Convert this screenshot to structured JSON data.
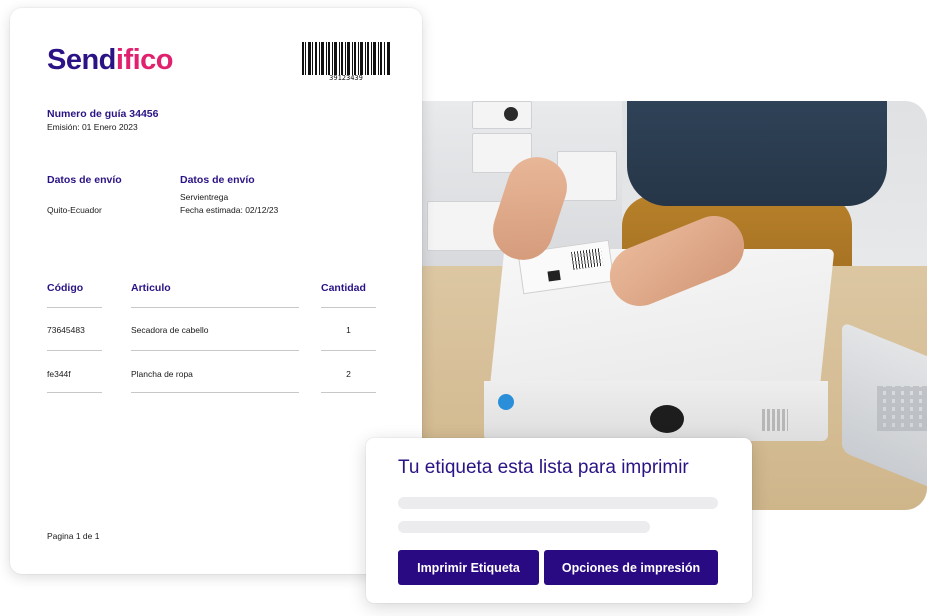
{
  "document": {
    "brand": {
      "part1": "Send",
      "part2": "ifico"
    },
    "barcode_number": "39123439",
    "guide": {
      "title": "Numero de guía 34456",
      "emission": "Emisión: 01 Enero 2023"
    },
    "shipping": [
      {
        "heading": "Datos de envío",
        "lines": [
          "",
          "Quito-Ecuador"
        ]
      },
      {
        "heading": "Datos de envío",
        "lines": [
          "Servientrega",
          "Fecha estimada: 02/12/23"
        ]
      }
    ],
    "table": {
      "headers": [
        "Código",
        "Articulo",
        "Cantidad"
      ],
      "rows": [
        [
          "73645483",
          "Secadora de cabello",
          "1"
        ],
        [
          "fe344f",
          "Plancha de ropa",
          "2"
        ]
      ]
    },
    "footer": "Pagina 1 de 1"
  },
  "dialog": {
    "title": "Tu etiqueta esta lista para imprimir",
    "print_button": "Imprimir Etiqueta",
    "options_button": "Opciones de impresión"
  },
  "colors": {
    "brand_primary": "#2b1385",
    "brand_accent": "#e0226e",
    "button_bg": "#2a0a83"
  },
  "photo": {
    "subject": "person-labeling-package-photo"
  }
}
